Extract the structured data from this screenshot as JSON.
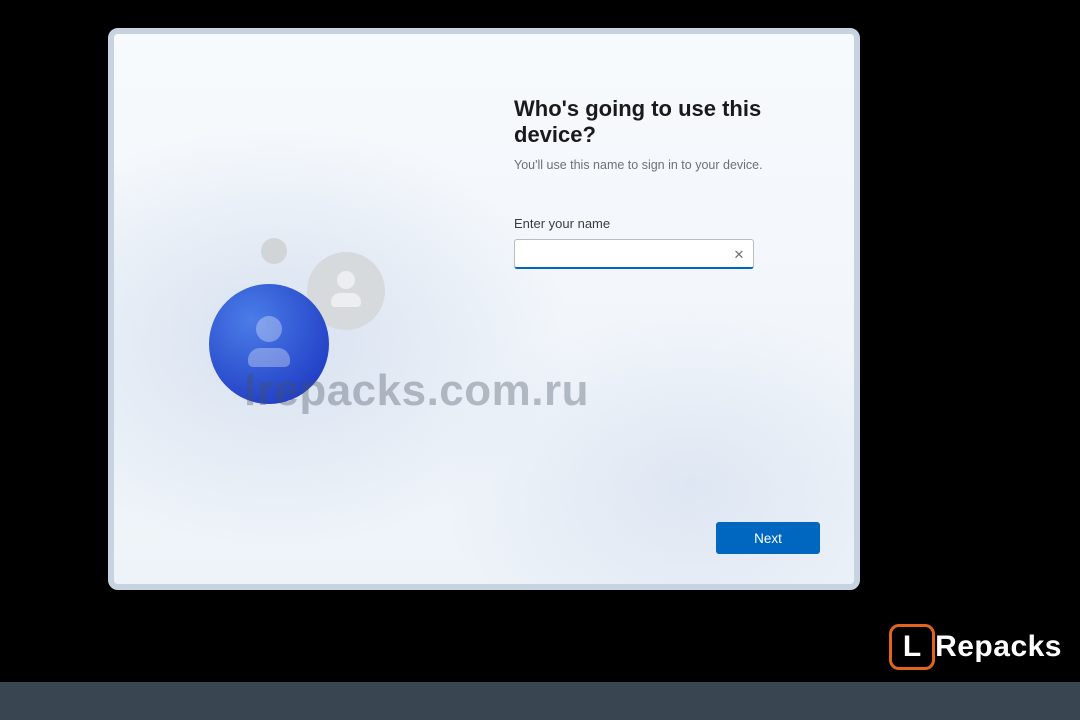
{
  "setup": {
    "heading": "Who's going to use this device?",
    "subheading": "You'll use this name to sign in to your device.",
    "field_label": "Enter your name",
    "name_value": "",
    "name_placeholder": "",
    "clear_glyph": "✕",
    "next_label": "Next"
  },
  "watermark": "lrepacks.com.ru",
  "brand": {
    "icon_letter": "L",
    "word": "Repacks"
  },
  "colors": {
    "accent": "#0067c0",
    "brand_orange": "#e0651f"
  }
}
